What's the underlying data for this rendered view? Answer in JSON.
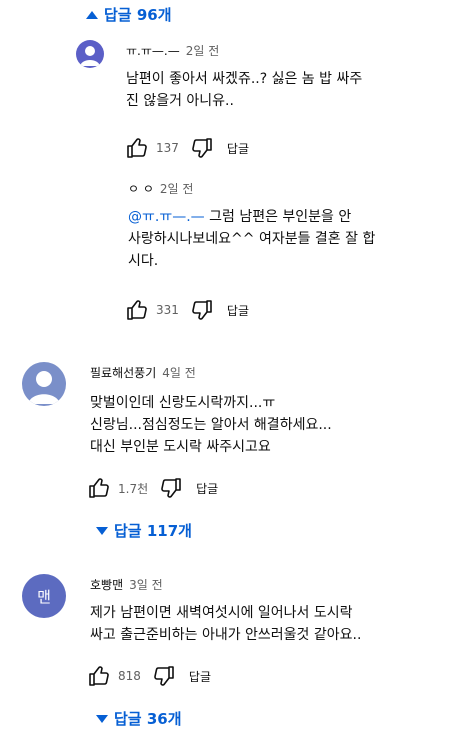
{
  "thread1": {
    "replies_toggle": "답글 96개",
    "reply1": {
      "author": "ㅠ.ㅠ—.—",
      "time": "2일 전",
      "text": "남편이 좋아서 싸겠쥬..? 싫은 놈 밥 싸주\n진 않을거 아니유..",
      "likes": "137",
      "reply_label": "답글"
    },
    "reply2": {
      "author": "ㅇ ㅇ",
      "time": "2일 전",
      "mention": "@ㅠ.ㅠ—.—",
      "text_line1": " 그럼 남편은 부인분을 안",
      "text_rest": "사랑하시나보네요^^ 여자분들 결혼 잘 합\n시다.",
      "likes": "331",
      "reply_label": "답글"
    }
  },
  "comment2": {
    "author": "필료해선풍기",
    "time": "4일 전",
    "text": "맞벌이인데 신랑도시락까지...ㅠ\n신랑님...점심정도는 알아서 해결하세요...\n대신 부인분 도시락 싸주시고요",
    "likes": "1.7천",
    "reply_label": "답글",
    "replies_toggle": "답글 117개"
  },
  "comment3": {
    "author": "호빵맨",
    "time": "3일 전",
    "avatar_letter": "맨",
    "text": "제가 남편이면 새벽여섯시에 일어나서 도시락\n싸고 출근준비하는 아내가 안쓰러울것 같아요..",
    "likes": "818",
    "reply_label": "답글",
    "replies_toggle": "답글 36개"
  },
  "colors": {
    "link_blue": "#065fd4",
    "avatar_purple": "#5b5fc7",
    "avatar_gray": "#7a8fc9",
    "avatar_indigo": "#5c6bc0"
  },
  "icons": [
    "caret-up-icon",
    "caret-down-icon",
    "thumbs-up-icon",
    "thumbs-down-icon",
    "default-avatar-icon"
  ]
}
